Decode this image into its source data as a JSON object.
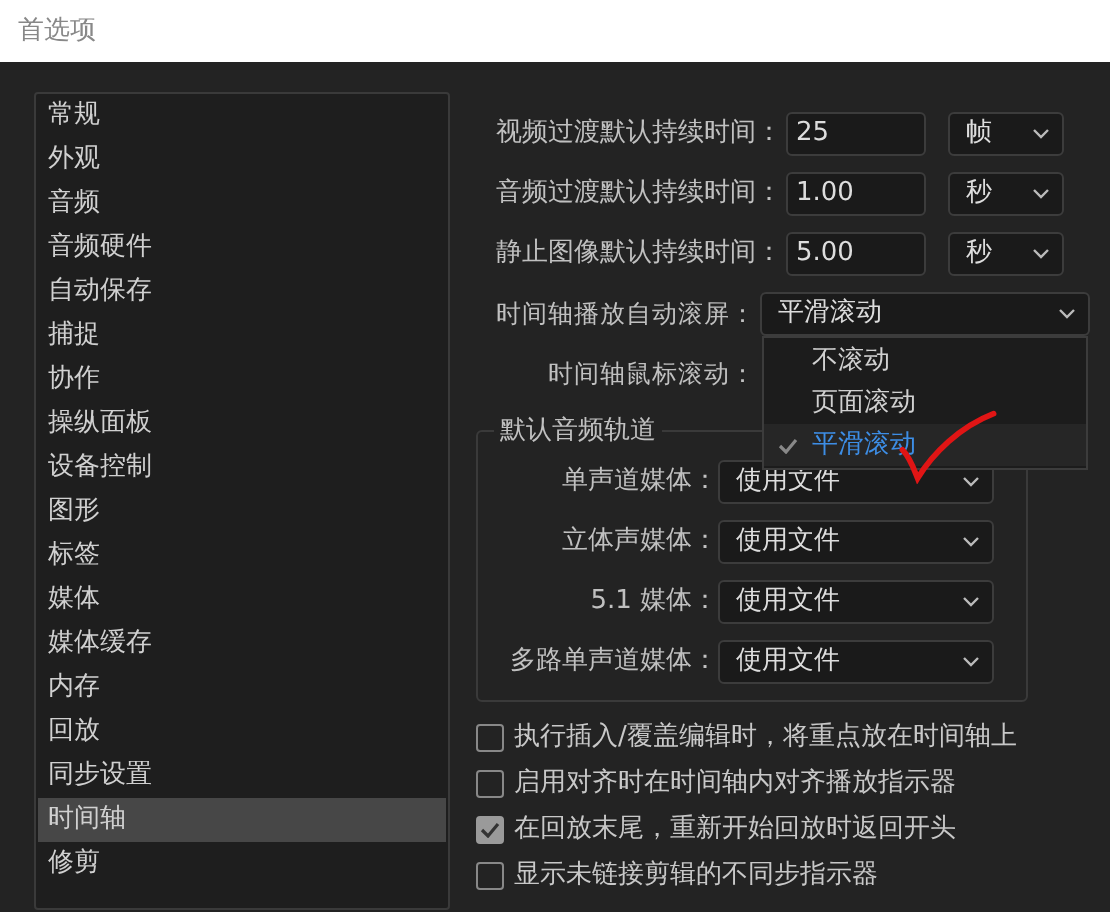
{
  "window": {
    "title": "首选项"
  },
  "sidebar": {
    "items": [
      {
        "label": "常规",
        "selected": false
      },
      {
        "label": "外观",
        "selected": false
      },
      {
        "label": "音频",
        "selected": false
      },
      {
        "label": "音频硬件",
        "selected": false
      },
      {
        "label": "自动保存",
        "selected": false
      },
      {
        "label": "捕捉",
        "selected": false
      },
      {
        "label": "协作",
        "selected": false
      },
      {
        "label": "操纵面板",
        "selected": false
      },
      {
        "label": "设备控制",
        "selected": false
      },
      {
        "label": "图形",
        "selected": false
      },
      {
        "label": "标签",
        "selected": false
      },
      {
        "label": "媒体",
        "selected": false
      },
      {
        "label": "媒体缓存",
        "selected": false
      },
      {
        "label": "内存",
        "selected": false
      },
      {
        "label": "回放",
        "selected": false
      },
      {
        "label": "同步设置",
        "selected": false
      },
      {
        "label": "时间轴",
        "selected": true
      },
      {
        "label": "修剪",
        "selected": false
      }
    ]
  },
  "fields": [
    {
      "kind": "number",
      "label": "视频过渡默认持续时间：",
      "value": "25",
      "unit": "帧"
    },
    {
      "kind": "number",
      "label": "音频过渡默认持续时间：",
      "value": "1.00",
      "unit": "秒"
    },
    {
      "kind": "number",
      "label": "静止图像默认持续时间：",
      "value": "5.00",
      "unit": "秒"
    },
    {
      "kind": "dropdown",
      "label": "时间轴播放自动滚屏：",
      "value": "平滑滚动",
      "expanded": true,
      "options": [
        {
          "label": "不滚动",
          "selected": false
        },
        {
          "label": "页面滚动",
          "selected": false
        },
        {
          "label": "平滑滚动",
          "selected": true
        }
      ]
    },
    {
      "kind": "dropdown",
      "label": "时间轴鼠标滚动："
    }
  ],
  "audio_tracks": {
    "title": "默认音频轨道",
    "rows": [
      {
        "label": "单声道媒体：",
        "value": "使用文件"
      },
      {
        "label": "立体声媒体：",
        "value": "使用文件"
      },
      {
        "label": "5.1 媒体：",
        "value": "使用文件"
      },
      {
        "label": "多路单声道媒体：",
        "value": "使用文件"
      }
    ]
  },
  "checkboxes": [
    {
      "label": "执行插入/覆盖编辑时，将重点放在时间轴上",
      "checked": false
    },
    {
      "label": "启用对齐时在时间轴内对齐播放指示器",
      "checked": false
    },
    {
      "label": "在回放末尾，重新开始回放时返回开头",
      "checked": true
    },
    {
      "label": "显示未链接剪辑的不同步指示器",
      "checked": false
    }
  ]
}
